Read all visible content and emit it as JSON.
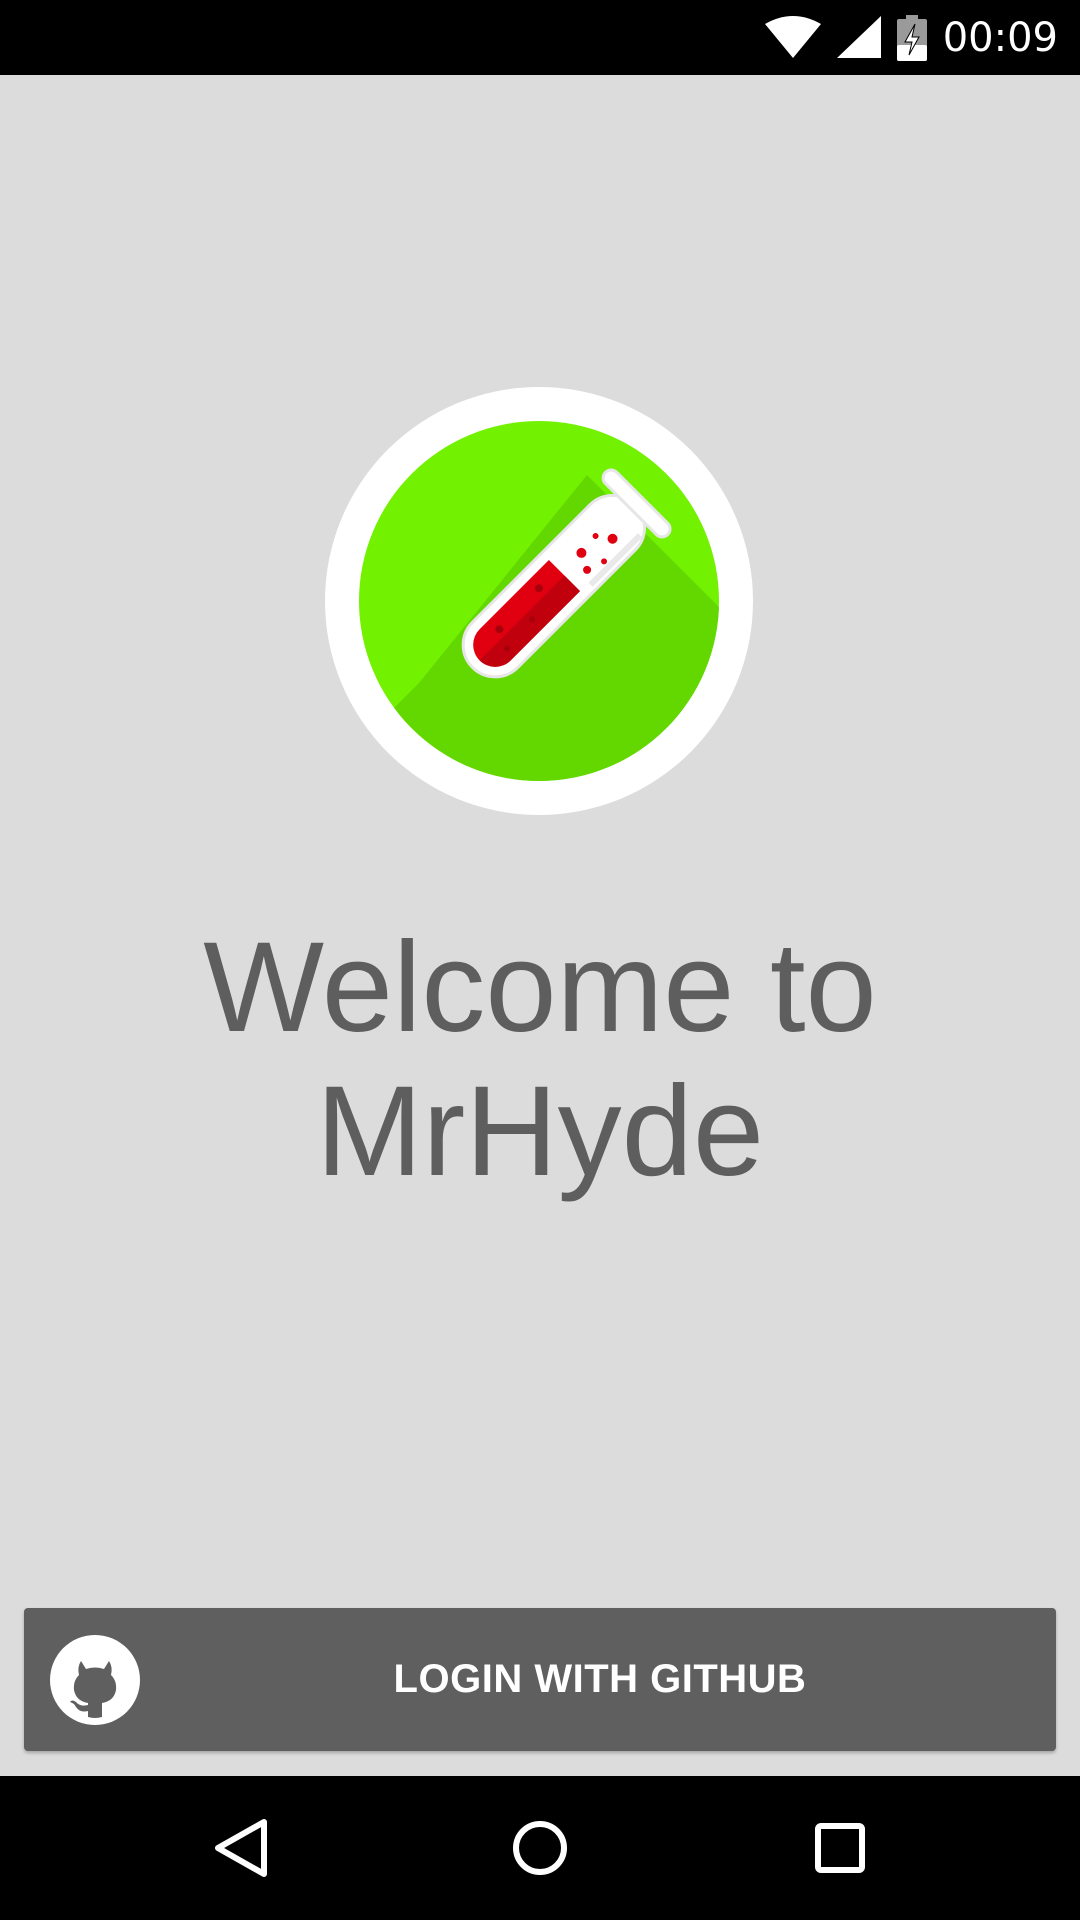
{
  "status_bar": {
    "time": "00:09",
    "icons": [
      "wifi-icon",
      "cell-signal-icon",
      "battery-charging-icon"
    ]
  },
  "logo": {
    "icon": "test-tube-icon",
    "colors": {
      "ring": "#ffffff",
      "circle": "#72f100",
      "shadow": "#62d800",
      "liquid": "#e00010"
    }
  },
  "welcome": {
    "line1": "Welcome to",
    "line2": "MrHyde"
  },
  "login": {
    "label": "LOGIN WITH GITHUB",
    "icon": "github-icon"
  },
  "nav_bar": {
    "buttons": [
      "back-icon",
      "home-icon",
      "recents-icon"
    ]
  },
  "colors": {
    "background": "#dcdcdc",
    "text": "#5e5e5e",
    "button": "#5f5f5f"
  }
}
